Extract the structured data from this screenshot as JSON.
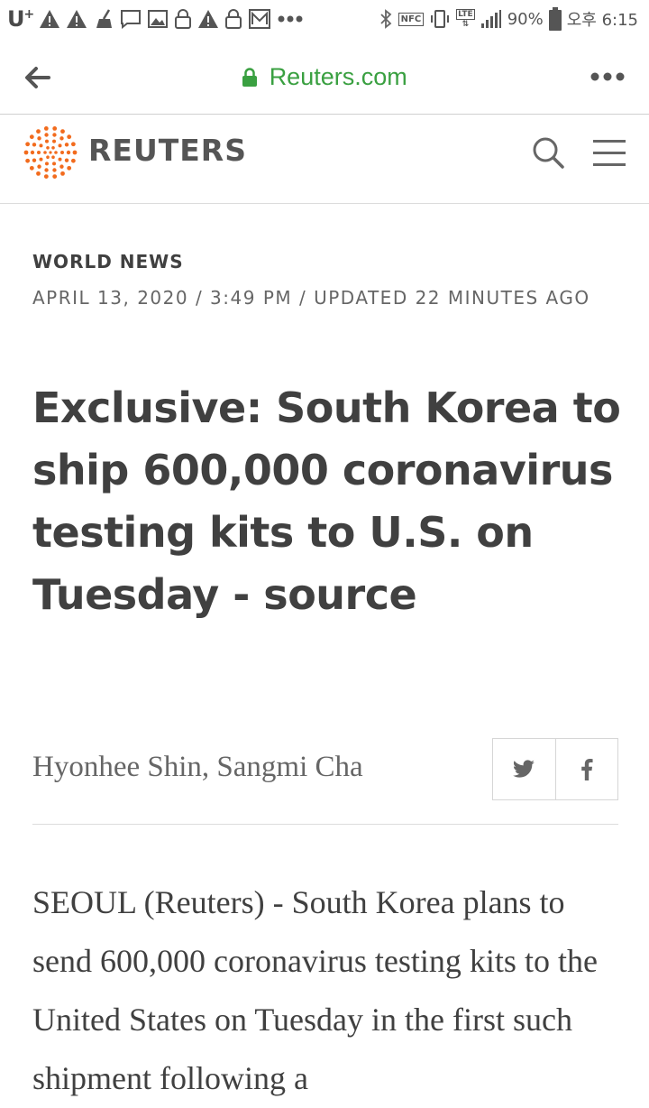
{
  "status_bar": {
    "carrier": "U",
    "carrier_sup": "+",
    "battery": "90%",
    "time": "오후 6:15",
    "nfc_label": "NFC",
    "lte_label": "LTE",
    "icons": [
      "warning-icon",
      "warning-icon",
      "cleaner-icon",
      "message-icon",
      "image-icon",
      "lock-icon",
      "warning-icon",
      "lock-icon",
      "mail-icon",
      "more-dots-icon",
      "bluetooth-icon",
      "nfc-icon",
      "vibrate-icon",
      "lte-icon",
      "signal-icon",
      "battery-icon"
    ]
  },
  "browser": {
    "url": "Reuters.com",
    "accent_color": "#3aa041"
  },
  "site": {
    "brand": "REUTERS",
    "brand_color": "#f26b1d"
  },
  "article": {
    "kicker": "WORLD NEWS",
    "dateline": "APRIL 13, 2020 / 3:49 PM / UPDATED 22 MINUTES AGO",
    "headline": "Exclusive: South Korea to ship 600,000 coronavirus testing kits to U.S. on Tuesday - source",
    "byline": "Hyonhee Shin, Sangmi Cha",
    "body": "SEOUL (Reuters) - South Korea plans to send 600,000 coronavirus testing kits to the United States on Tuesday in the first such shipment following a"
  }
}
